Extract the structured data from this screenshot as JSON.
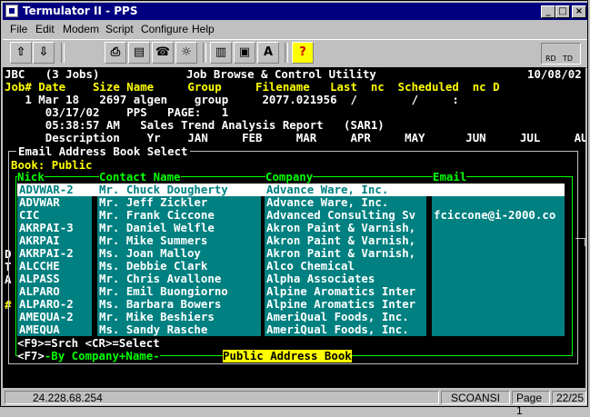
{
  "window": {
    "title": "Termulator II - PPS"
  },
  "menu": [
    "File",
    "Edit",
    "Modem",
    "Script",
    "Configure",
    "Help"
  ],
  "toolbar": {
    "font_btn": "A",
    "help_btn": "?",
    "rd": "RD",
    "td": "TD"
  },
  "term": {
    "line0_left": "JBC   (3 Jobs)",
    "line0_mid": "Job Browse & Control Utility",
    "line0_right": "10/08/02",
    "hdr": "Job# Date    Size Name     Group     Filename   Last  nc  Scheduled  nc D",
    "job1": "   1 Mar 18   2697 algen    group     2077.021956  /        /     :",
    "job2": "      03/17/02    PPS   PAGE:   1",
    "job3": "      05:38:57 AM   Sales Trend Analysis Report   (SAR1)",
    "job4": "      Description    Yr    JAN     FEB     MAR     APR     MAY      JUN     JUL     AUG",
    "dlg_title": "Email Address Book Select",
    "book": "Book: Public",
    "col_nick": "Nick",
    "col_contact": "Contact Name",
    "col_company": "Company",
    "col_email": "Email",
    "rows": [
      {
        "nick": "ADVWAR-2",
        "contact": "Mr. Chuck Dougherty",
        "company": "Advance Ware, Inc.",
        "email": ""
      },
      {
        "nick": "ADVWAR",
        "contact": "Mr. Jeff Zickler",
        "company": "Advance Ware, Inc.",
        "email": ""
      },
      {
        "nick": "CIC",
        "contact": "Mr. Frank Ciccone",
        "company": "Advanced Consulting Sv",
        "email": "fciccone@i-2000.co"
      },
      {
        "nick": "AKRPAI-3",
        "contact": "Mr. Daniel Welfle",
        "company": "Akron Paint & Varnish,",
        "email": ""
      },
      {
        "nick": "AKRPAI",
        "contact": "Mr. Mike Summers",
        "company": "Akron Paint & Varnish,",
        "email": ""
      },
      {
        "nick": "AKRPAI-2",
        "contact": "Ms. Joan Malloy",
        "company": "Akron Paint & Varnish,",
        "email": ""
      },
      {
        "nick": "ALCCHE",
        "contact": "Ms. Debbie Clark",
        "company": "Alco Chemical",
        "email": ""
      },
      {
        "nick": "ALPASS",
        "contact": "Mr. Chris Avallone",
        "company": "Alpha Associates",
        "email": ""
      },
      {
        "nick": "ALPARO",
        "contact": "Mr. Emil Buongiorno",
        "company": "Alpine Aromatics Inter",
        "email": ""
      },
      {
        "nick": "ALPARO-2",
        "contact": "Ms. Barbara Bowers",
        "company": "Alpine Aromatics Inter",
        "email": ""
      },
      {
        "nick": "AMEQUA-2",
        "contact": "Mr. Mike Beshiers",
        "company": "AmeriQual Foods, Inc.",
        "email": ""
      },
      {
        "nick": "AMEQUA",
        "contact": "Ms. Sandy Rasche",
        "company": "AmeriQual Foods, Inc.",
        "email": ""
      }
    ],
    "keys1": "<F9>=Srch <CR>=Select",
    "keys2a": "<F7>",
    "keys2b": "-By Company+Name-",
    "book_label": "Public Address Book",
    "side": [
      "D",
      "T",
      "A",
      "",
      "#"
    ]
  },
  "status": {
    "ip": "24.228.68.254",
    "mode": "SCOANSI",
    "page": "Page 1",
    "pos": "22/25"
  }
}
